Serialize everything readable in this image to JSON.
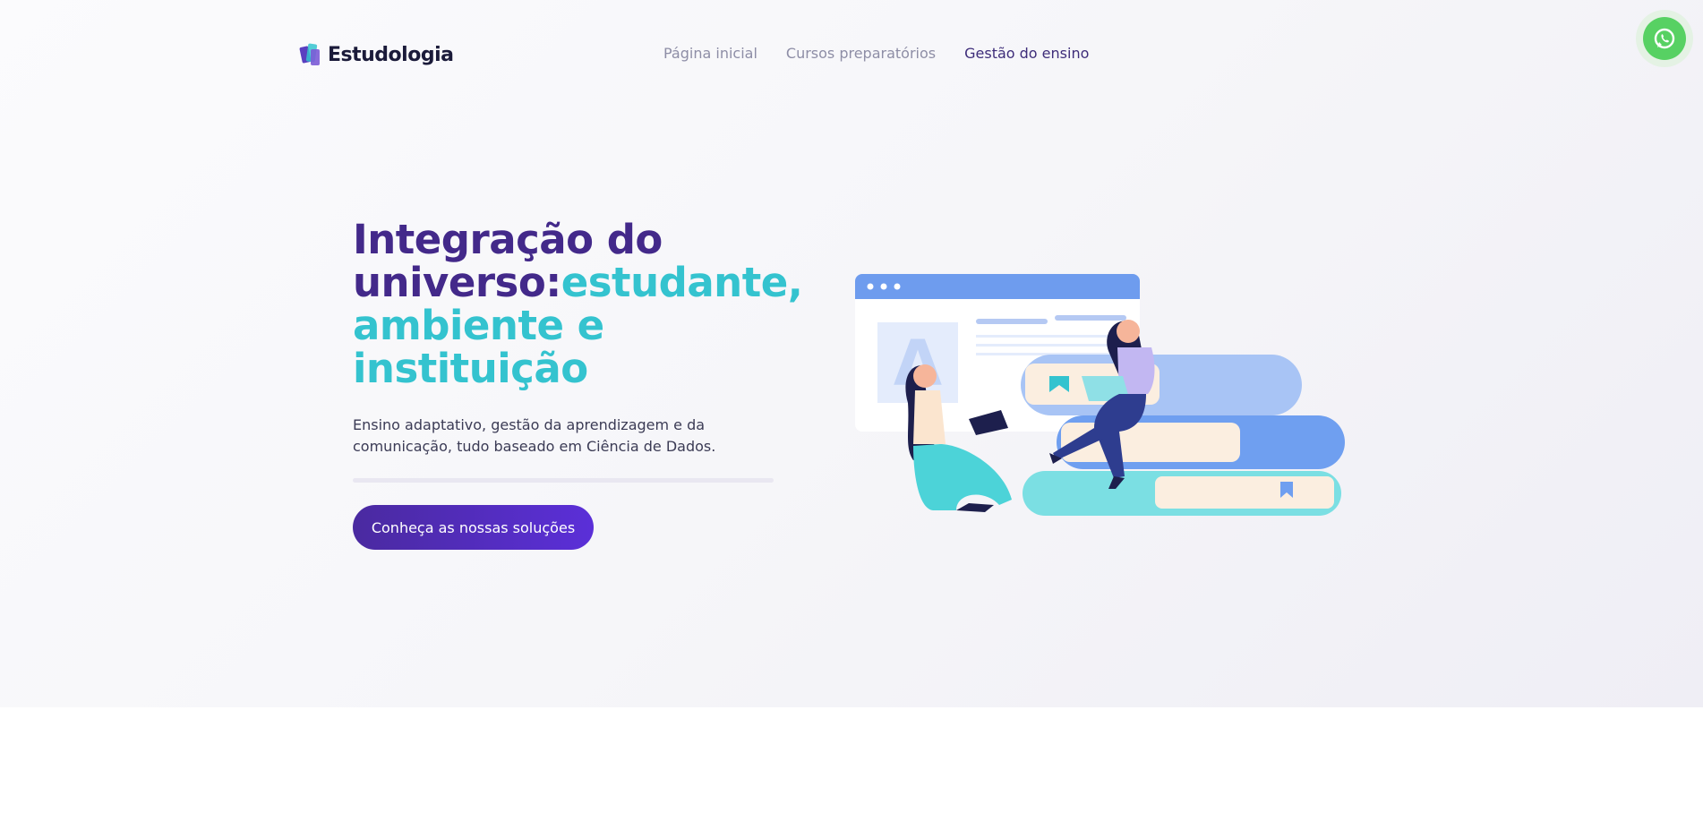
{
  "brand": {
    "name": "Estudologia"
  },
  "nav": {
    "items": [
      {
        "label": "Página inicial"
      },
      {
        "label": "Cursos preparatórios"
      },
      {
        "label": "Gestão do ensino"
      }
    ]
  },
  "hero": {
    "headline_dark": "Integração do universo:",
    "headline_teal": "estudante, ambiente e instituição",
    "subtitle": "Ensino adaptativo, gestão da aprendizagem e da comunicação, tudo baseado em Ciência de Dados.",
    "cta_label": "Conheça as nossas soluções"
  },
  "illustration": {
    "browser_letter": "A"
  },
  "colors": {
    "primary": "#43298a",
    "accent": "#34c3cf",
    "cta": "#5b2fd8",
    "whatsapp": "#57d163"
  },
  "icons": {
    "whatsapp": "whatsapp-icon",
    "logo": "logo-mark-icon"
  }
}
